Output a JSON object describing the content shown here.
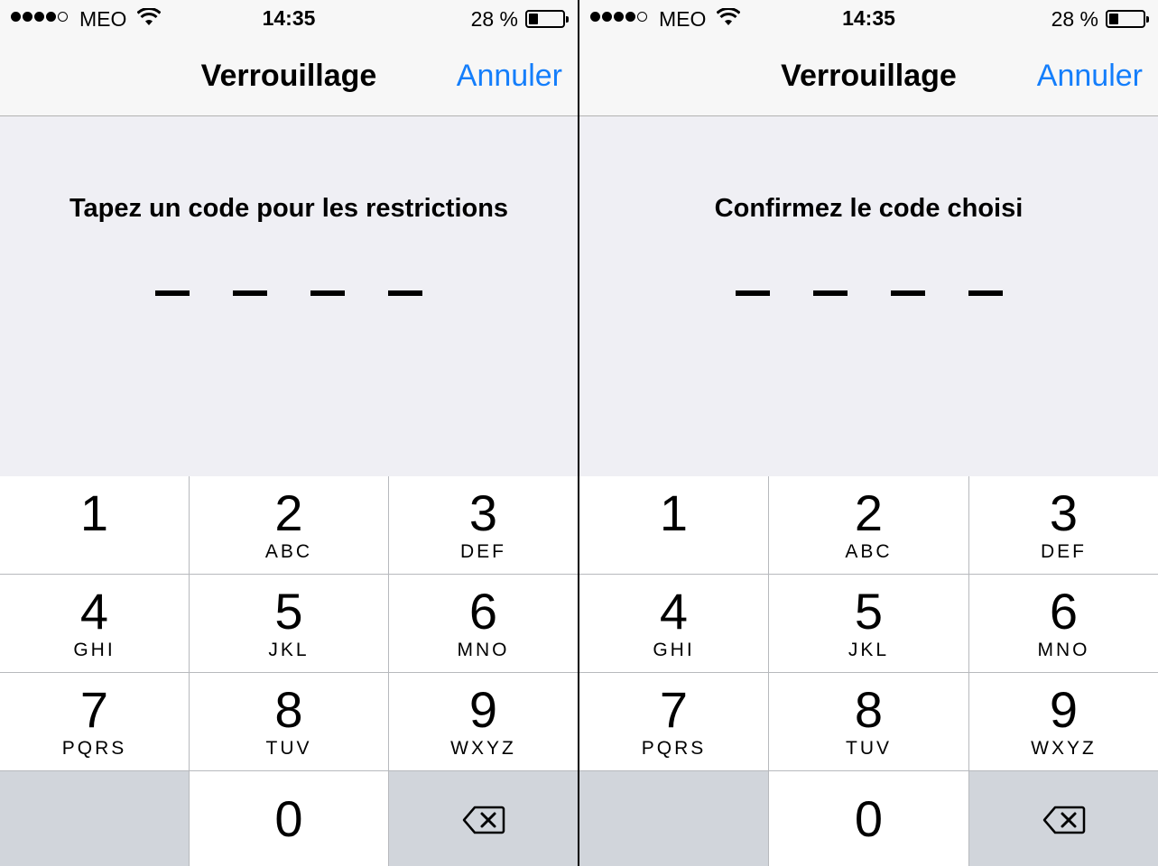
{
  "status_bar": {
    "carrier": "MEO",
    "time": "14:35",
    "battery_text": "28 %",
    "battery_level": 0.28,
    "signal_filled": 4,
    "signal_total": 5
  },
  "panels": [
    {
      "nav": {
        "title": "Verrouillage",
        "cancel_label": "Annuler"
      },
      "prompt": "Tapez un code pour les restrictions"
    },
    {
      "nav": {
        "title": "Verrouillage",
        "cancel_label": "Annuler"
      },
      "prompt": "Confirmez le code choisi"
    }
  ],
  "keypad": {
    "k1": {
      "num": "1",
      "letters": ""
    },
    "k2": {
      "num": "2",
      "letters": "ABC"
    },
    "k3": {
      "num": "3",
      "letters": "DEF"
    },
    "k4": {
      "num": "4",
      "letters": "GHI"
    },
    "k5": {
      "num": "5",
      "letters": "JKL"
    },
    "k6": {
      "num": "6",
      "letters": "MNO"
    },
    "k7": {
      "num": "7",
      "letters": "PQRS"
    },
    "k8": {
      "num": "8",
      "letters": "TUV"
    },
    "k9": {
      "num": "9",
      "letters": "WXYZ"
    },
    "k0": {
      "num": "0",
      "letters": ""
    },
    "delete_icon": "backspace-icon"
  },
  "colors": {
    "accent": "#147efb",
    "background": "#efeff4",
    "key_grey": "#d1d5db"
  }
}
